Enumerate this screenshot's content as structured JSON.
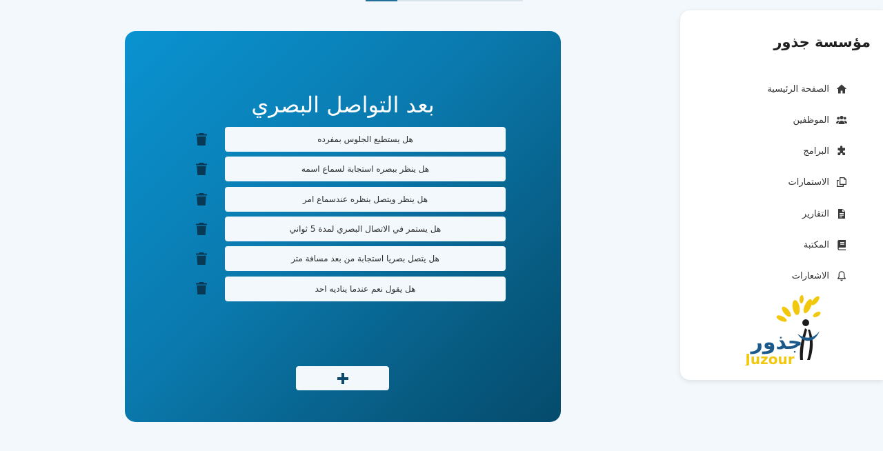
{
  "org": {
    "title": "مؤسسة جذور",
    "logo_arabic": "جذور",
    "logo_latin": "Juzour"
  },
  "sidebar": {
    "items": [
      {
        "label": "الصفحة الرئيسية",
        "icon": "home-icon"
      },
      {
        "label": "الموظفين",
        "icon": "users-icon"
      },
      {
        "label": "البرامج",
        "icon": "puzzle-icon"
      },
      {
        "label": "الاستمارات",
        "icon": "copy-forms-icon"
      },
      {
        "label": "التقارير",
        "icon": "file-report-icon"
      },
      {
        "label": "المكتبة",
        "icon": "book-icon"
      },
      {
        "label": "الاشعارات",
        "icon": "bell-icon"
      }
    ]
  },
  "main": {
    "title": "بعد التواصل البصري",
    "questions": [
      "هل يستطيع الجلوس بمفرده",
      "هل ينظر ببصره استجابة لسماع اسمه",
      "هل ينظر ويتصل بنظره عندسماع امر",
      "هل يستمر في الاتصال البصري لمدة 5 ثواني",
      "هل يتصل بصريا استجابة من بعد مسافة متر",
      "هل يقول نعم عندما يناديه احد"
    ],
    "add_button_icon": "plus-icon",
    "delete_icon": "trash-icon"
  },
  "colors": {
    "card_gradient_start": "#0a93d1",
    "card_gradient_end": "#054b6c",
    "background": "#f2f8fc",
    "logo_yellow": "#f2c80f",
    "logo_blue": "#1b5a8a"
  }
}
